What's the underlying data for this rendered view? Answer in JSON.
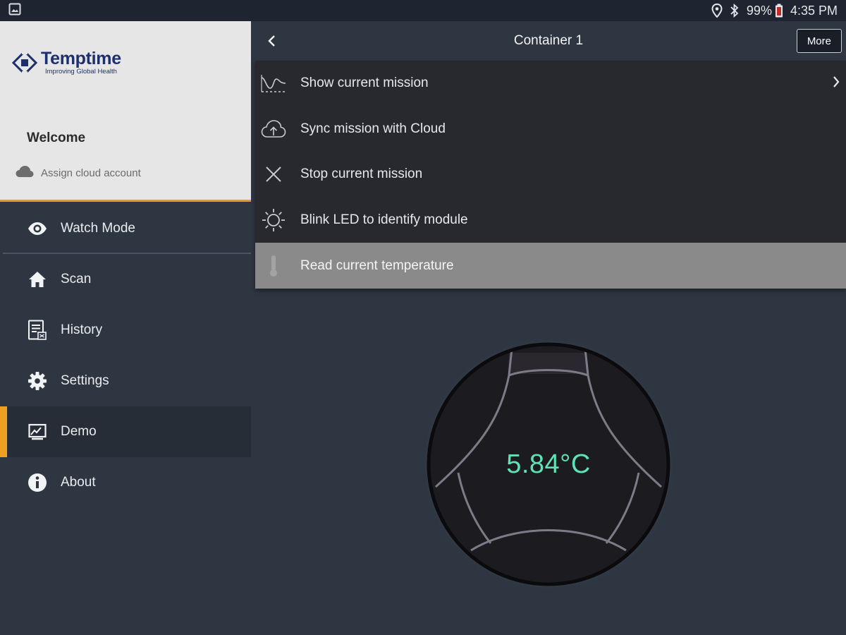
{
  "status_bar": {
    "battery": "99%",
    "time": "4:35 PM",
    "icons": [
      "gallery-icon",
      "location-icon",
      "bluetooth-icon",
      "battery-icon"
    ]
  },
  "drawer": {
    "brand_name": "Temptime",
    "brand_tagline": "Improving Global Health",
    "welcome": "Welcome",
    "cloud_account": "Assign cloud account",
    "accent_color": "#e89a1d"
  },
  "nav": {
    "items": [
      {
        "label": "Watch Mode",
        "icon": "eye-icon"
      },
      {
        "label": "Scan",
        "icon": "home-icon"
      },
      {
        "label": "History",
        "icon": "history-icon"
      },
      {
        "label": "Settings",
        "icon": "gear-icon"
      },
      {
        "label": "Demo",
        "icon": "demo-icon",
        "active": true
      },
      {
        "label": "About",
        "icon": "info-icon"
      }
    ]
  },
  "appbar": {
    "title": "Container 1",
    "more_label": "More"
  },
  "menu": {
    "items": [
      {
        "label": "Show current mission",
        "icon": "mission-chart-icon"
      },
      {
        "label": "Sync mission with Cloud",
        "icon": "cloud-upload-icon"
      },
      {
        "label": "Stop current mission",
        "icon": "close-icon"
      },
      {
        "label": "Blink LED to identify module",
        "icon": "led-sun-icon"
      },
      {
        "label": "Read current temperature",
        "icon": "thermometer-icon",
        "selected": true
      }
    ]
  },
  "temperature": {
    "reading": "5.84°C",
    "color": "#5fe3b4"
  }
}
